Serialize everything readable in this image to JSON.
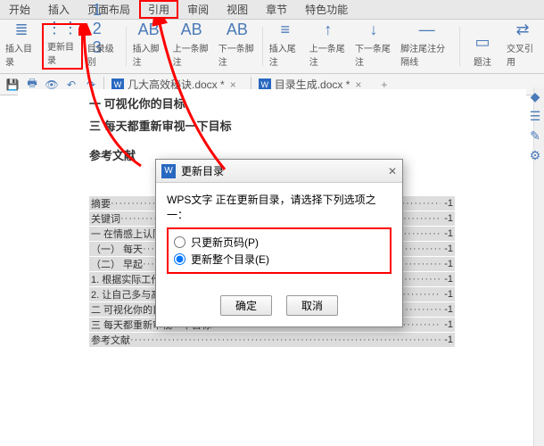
{
  "tabs": [
    "开始",
    "插入",
    "页面布局",
    "引用",
    "审阅",
    "视图",
    "章节",
    "特色功能"
  ],
  "hlTab": 3,
  "ribbon": [
    {
      "label": "插入目录",
      "glyph": "≣"
    },
    {
      "label": "更新目录",
      "glyph": "⋮⋮",
      "hl": true
    },
    {
      "label": "目录级别",
      "glyph": "1 2 3"
    },
    {
      "label": "插入脚注",
      "glyph": "AB"
    },
    {
      "label": "上一条脚注",
      "glyph": "AB"
    },
    {
      "label": "下一条脚注",
      "glyph": "AB"
    },
    {
      "label": "插入尾注",
      "glyph": "≡"
    },
    {
      "label": "上一条尾注",
      "glyph": "↑"
    },
    {
      "label": "下一条尾注",
      "glyph": "↓"
    },
    {
      "label": "脚注尾注分隔线",
      "glyph": "—"
    },
    {
      "label": "题注",
      "glyph": "▭"
    },
    {
      "label": "交叉引用",
      "glyph": "⇄"
    }
  ],
  "docTabs": [
    {
      "name": "几大高效秘诀.docx *"
    },
    {
      "name": "目录生成.docx *"
    }
  ],
  "body": {
    "l1": "一 可视化你的目标",
    "l2": "三 每天都重新审视一下目标",
    "l3": "参考文献"
  },
  "toc": [
    {
      "t": "摘要",
      "p": "-1"
    },
    {
      "t": "关键词",
      "p": "-1"
    },
    {
      "t": "一 在情感上认同",
      "p": "-1"
    },
    {
      "t": "（一） 每天",
      "p": "-1"
    },
    {
      "t": "（二） 早起",
      "p": "-1"
    },
    {
      "t": "1. 根据实际工作为身体补充能量",
      "p": "-1"
    },
    {
      "t": "2. 让自己多与高效人士在一起",
      "p": "-1"
    },
    {
      "t": "二 可视化你的目标",
      "p": "-1"
    },
    {
      "t": "三 每天都重新审视一下目标",
      "p": "-1"
    },
    {
      "t": "参考文献",
      "p": "-1"
    }
  ],
  "dialog": {
    "title": "更新目录",
    "msg": "WPS文字 正在更新目录，请选择下列选项之一：",
    "opt1": "只更新页码(P)",
    "opt2": "更新整个目录(E)",
    "ok": "确定",
    "cancel": "取消"
  }
}
